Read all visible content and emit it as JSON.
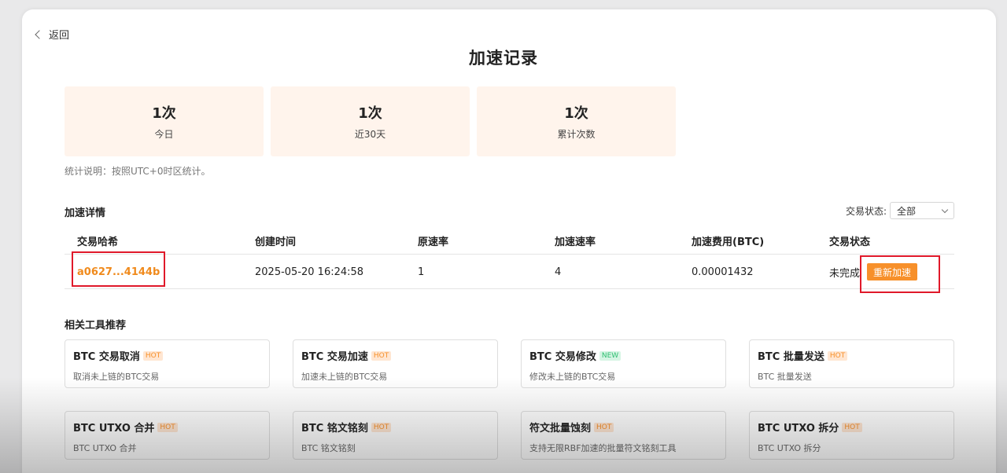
{
  "nav": {
    "back_label": "返回"
  },
  "page": {
    "title": "加速记录"
  },
  "stats": [
    {
      "value": "1次",
      "label": "今日"
    },
    {
      "value": "1次",
      "label": "近30天"
    },
    {
      "value": "1次",
      "label": "累计次数"
    }
  ],
  "stats_note": "统计说明：按照UTC+0时区统计。",
  "details": {
    "title": "加速详情",
    "filter_label": "交易状态:",
    "filter_value": "全部",
    "columns": [
      "交易哈希",
      "创建时间",
      "原速率",
      "加速速率",
      "加速费用(BTC)",
      "交易状态"
    ],
    "rows": [
      {
        "hash": "a0627...4144b",
        "created": "2025-05-20 16:24:58",
        "orig_rate": "1",
        "accel_rate": "4",
        "fee": "0.00001432",
        "status": "未完成",
        "action": "重新加速"
      }
    ]
  },
  "tools": {
    "title": "相关工具推荐",
    "items": [
      {
        "name": "BTC 交易取消",
        "badge": "HOT",
        "desc": "取消未上链的BTC交易"
      },
      {
        "name": "BTC 交易加速",
        "badge": "HOT",
        "desc": "加速未上链的BTC交易"
      },
      {
        "name": "BTC 交易修改",
        "badge": "NEW",
        "desc": "修改未上链的BTC交易"
      },
      {
        "name": "BTC 批量发送",
        "badge": "HOT",
        "desc": "BTC 批量发送"
      },
      {
        "name": "BTC UTXO 合并",
        "badge": "HOT",
        "desc": "BTC UTXO 合并"
      },
      {
        "name": "BTC 铭文铭刻",
        "badge": "HOT",
        "desc": "BTC 铭文铭刻"
      },
      {
        "name": "符文批量蚀刻",
        "badge": "HOT",
        "desc": "支持无限RBF加速的批量符文铭刻工具"
      },
      {
        "name": "BTC UTXO 拆分",
        "badge": "HOT",
        "desc": "BTC UTXO 拆分"
      }
    ]
  },
  "colors": {
    "accent": "#f7902a",
    "stat_bg": "#fff4ec",
    "highlight": "#e0192a"
  }
}
